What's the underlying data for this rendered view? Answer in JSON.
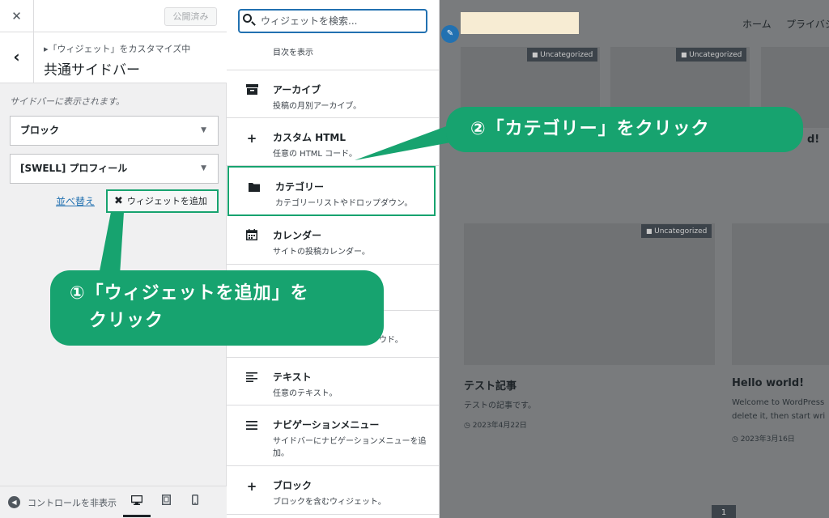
{
  "customizer": {
    "close_icon": "close-icon",
    "publish_button": "公開済み",
    "breadcrumb": "▸「ウィジェット」をカスタマイズ中",
    "section_title": "共通サイドバー",
    "sidebar_description": "サイドバーに表示されます。",
    "widgets": [
      {
        "label": "ブロック"
      },
      {
        "label": "[SWELL] プロフィール"
      }
    ],
    "reorder_link": "並べ替え",
    "add_widget_button": "ウィジェットを追加",
    "footer": {
      "collapse_label": "コントロールを非表示",
      "devices": [
        "desktop",
        "tablet",
        "mobile"
      ],
      "active_device": "desktop"
    }
  },
  "available_widgets": {
    "search_placeholder": "ウィジェットを検索...",
    "items": [
      {
        "title": "",
        "desc": "目次を表示",
        "icon": "toc-icon"
      },
      {
        "title": "アーカイブ",
        "desc": "投稿の月別アーカイブ。",
        "icon": "archive-icon"
      },
      {
        "title": "カスタム HTML",
        "desc": "任意の HTML コード。",
        "icon": "plus-icon"
      },
      {
        "title": "カテゴリー",
        "desc": "カテゴリーリストやドロップダウン。",
        "icon": "folder-icon"
      },
      {
        "title": "カレンダー",
        "desc": "サイトの投稿カレンダー。",
        "icon": "calendar-icon"
      },
      {
        "title": "",
        "desc": "ラウド。",
        "icon": ""
      },
      {
        "title": "テキスト",
        "desc": "任意のテキスト。",
        "icon": "text-icon"
      },
      {
        "title": "ナビゲーションメニュー",
        "desc": "サイドバーにナビゲーションメニューを追加。",
        "icon": "menu-icon"
      },
      {
        "title": "ブロック",
        "desc": "ブロックを含むウィジェット。",
        "icon": "plus-icon"
      }
    ]
  },
  "preview": {
    "nav": [
      "ホーム",
      "プライバシ"
    ],
    "badge": "Uncategorized",
    "peek_text": "d!",
    "post1": {
      "title": "テスト記事",
      "excerpt": "テストの記事です。",
      "date": "2023年4月22日"
    },
    "post2": {
      "title": "Hello world!",
      "excerpt1": "Welcome to WordPress",
      "excerpt2": "delete it, then start wri",
      "date": "2023年3月16日"
    },
    "pager": "1"
  },
  "callouts": {
    "one_line1": "①「ウィジェットを追加」を",
    "one_line2": "クリック",
    "two": "②「カテゴリー」をクリック",
    "color": "#17a36f"
  }
}
